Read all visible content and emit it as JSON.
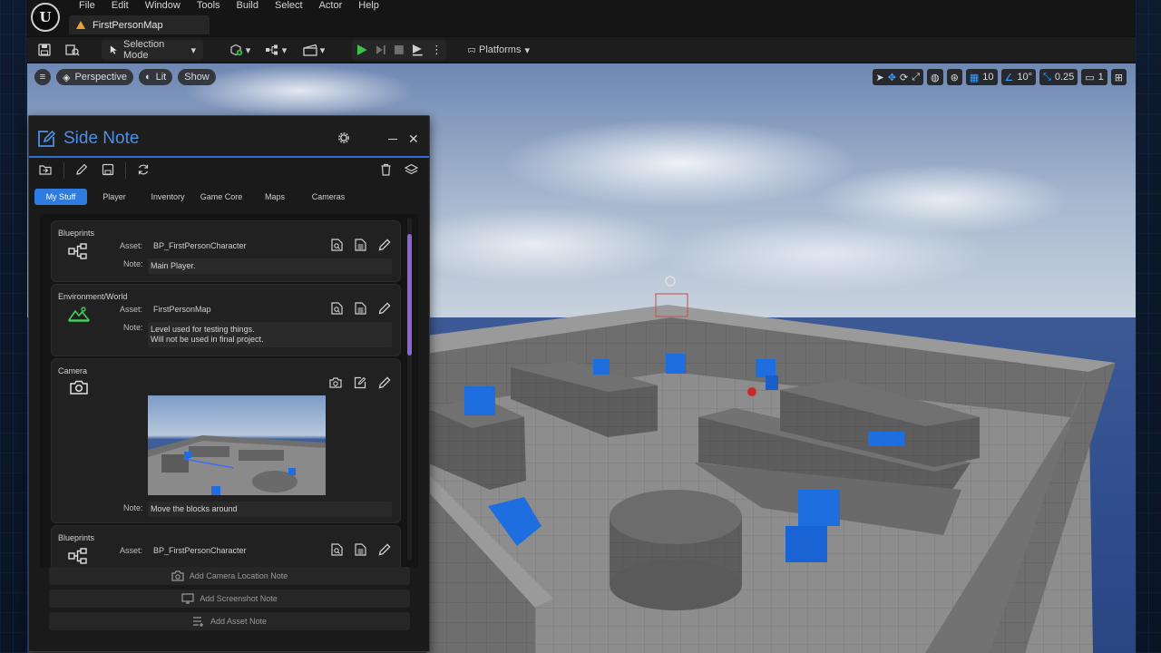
{
  "menu": {
    "items": [
      "File",
      "Edit",
      "Window",
      "Tools",
      "Build",
      "Select",
      "Actor",
      "Help"
    ]
  },
  "map_tab": {
    "label": "FirstPersonMap"
  },
  "toolbar": {
    "selection_mode": "Selection Mode",
    "platforms": "Platforms"
  },
  "viewport": {
    "perspective": "Perspective",
    "lit": "Lit",
    "show": "Show",
    "grid_snap": "10",
    "rotation_snap": "10°",
    "scale_snap": "0.25",
    "camera_speed": "1"
  },
  "side_note": {
    "title": "Side Note",
    "tabs": [
      "My Stuff",
      "Player",
      "Inventory",
      "Game Core",
      "Maps",
      "Cameras"
    ],
    "cards": [
      {
        "category": "Blueprints",
        "asset_label": "Asset:",
        "asset": "BP_FirstPersonCharacter",
        "note_label": "Note:",
        "note": "Main Player."
      },
      {
        "category": "Environment/World",
        "asset_label": "Asset:",
        "asset": "FirstPersonMap",
        "note_label": "Note:",
        "note_line1": "Level used for testing things.",
        "note_line2": "Will not be used in final project."
      },
      {
        "category": "Camera",
        "note_label": "Note:",
        "note": "Move the blocks around"
      },
      {
        "category": "Blueprints",
        "asset_label": "Asset:",
        "asset": "BP_FirstPersonCharacter"
      }
    ],
    "buttons": {
      "camera_note": "Add Camera Location Note",
      "screenshot_note": "Add Screenshot Note",
      "asset_note": "Add Asset Note"
    }
  },
  "colors": {
    "accent": "#2f7be0",
    "title": "#4d8fe6",
    "play": "#3cc24a",
    "scrollbar": "#8e63d6",
    "env_icon": "#3fcf5a",
    "cube": "#1f6fe0"
  }
}
